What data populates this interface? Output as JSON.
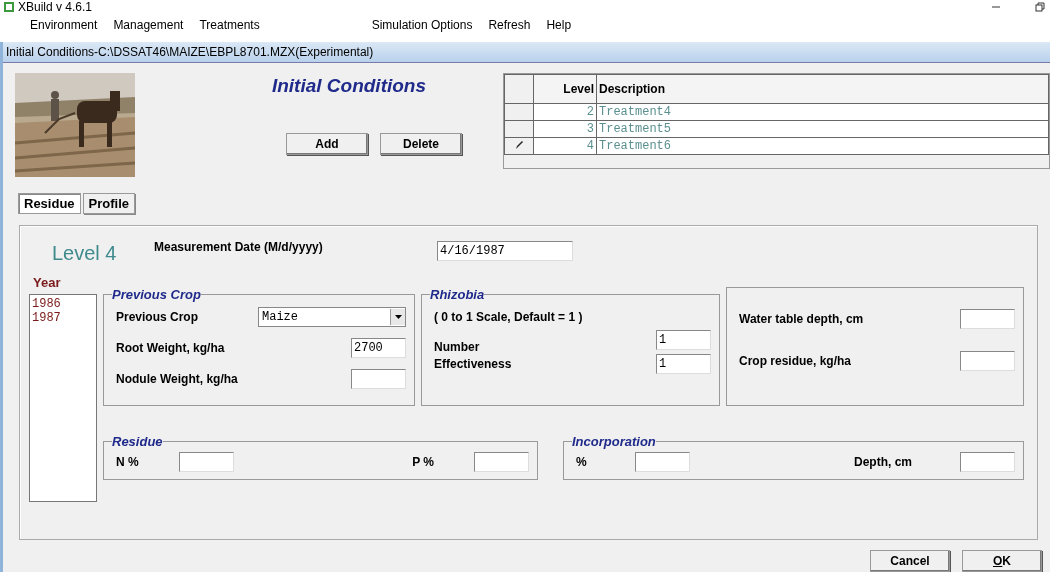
{
  "app": {
    "title": "XBuild v 4.6.1"
  },
  "menu": [
    "Environment",
    "Management",
    "Treatments",
    "Simulation Options",
    "Refresh",
    "Help"
  ],
  "window": {
    "title": "Initial Conditions-C:\\DSSAT46\\MAIZE\\EBPL8701.MZX(Experimental)"
  },
  "heading": "Initial Conditions",
  "buttons": [
    "Add",
    "Delete"
  ],
  "table": {
    "columns": [
      "Level",
      "Description"
    ],
    "rows": [
      {
        "level": "2",
        "description": "Treatment4",
        "editing": false
      },
      {
        "level": "3",
        "description": "Treatment5",
        "editing": false
      },
      {
        "level": "4",
        "description": "Treatment6",
        "editing": true
      }
    ]
  },
  "tabs": [
    {
      "label": "Residue",
      "selected": true
    },
    {
      "label": "Profile",
      "selected": false
    }
  ],
  "level_title": "Level 4",
  "measurement_date": {
    "label": "Measurement Date (M/d/yyyy)",
    "value": "4/16/1987"
  },
  "year": {
    "label": "Year",
    "items": [
      "1986",
      "1987"
    ]
  },
  "previous_crop": {
    "title": "Previous Crop",
    "fields": [
      {
        "label": "Previous Crop",
        "kind": "dropdown",
        "value": "Maize"
      },
      {
        "label": "Root Weight, kg/ha",
        "kind": "text",
        "value": "2700"
      },
      {
        "label": "Nodule Weight, kg/ha",
        "kind": "text"
      }
    ]
  },
  "rhizobia": {
    "title": "Rhizobia",
    "note": "( 0 to 1 Scale, Default = 1 )",
    "fields": [
      {
        "label": "Number",
        "value": "1"
      },
      {
        "label": "Effectiveness",
        "value": "1"
      }
    ]
  },
  "water": {
    "fields": [
      {
        "label": "Water table depth, cm"
      },
      {
        "label": "Crop residue, kg/ha"
      }
    ]
  },
  "residue": {
    "title": "Residue",
    "fields": [
      {
        "label": "N %"
      },
      {
        "label": "P %"
      }
    ]
  },
  "incorporation": {
    "title": "Incorporation",
    "fields": [
      {
        "label": "%"
      },
      {
        "label": "Depth, cm"
      }
    ]
  },
  "dialog_buttons": [
    "Cancel",
    "OK"
  ]
}
